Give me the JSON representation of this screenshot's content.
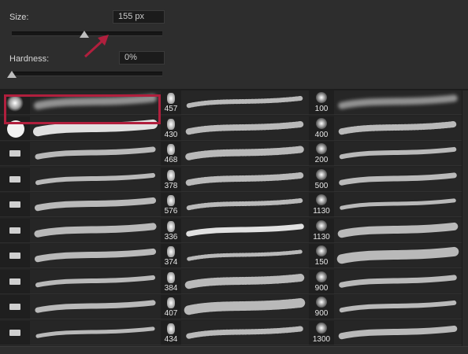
{
  "controls": {
    "size_label": "Size:",
    "size_value": "155 px",
    "size_level_percent": 48,
    "hardness_label": "Hardness:",
    "hardness_value": "0%",
    "hardness_level_percent": 0
  },
  "presets": {
    "column_b_numbers": [
      "457",
      "430",
      "468",
      "378",
      "576",
      "336",
      "374",
      "384",
      "407",
      "434"
    ],
    "column_d_numbers": [
      "100",
      "400",
      "200",
      "500",
      "1130",
      "1130",
      "150",
      "900",
      "900",
      "1300"
    ],
    "selected_index": 0
  },
  "colors": {
    "accent_highlight": "#b01f3d",
    "annotation_arrow": "#b01f3d"
  },
  "icons": [
    "arrow-annotation-icon",
    "slider-thumb-icon",
    "brush-tip-icon"
  ]
}
